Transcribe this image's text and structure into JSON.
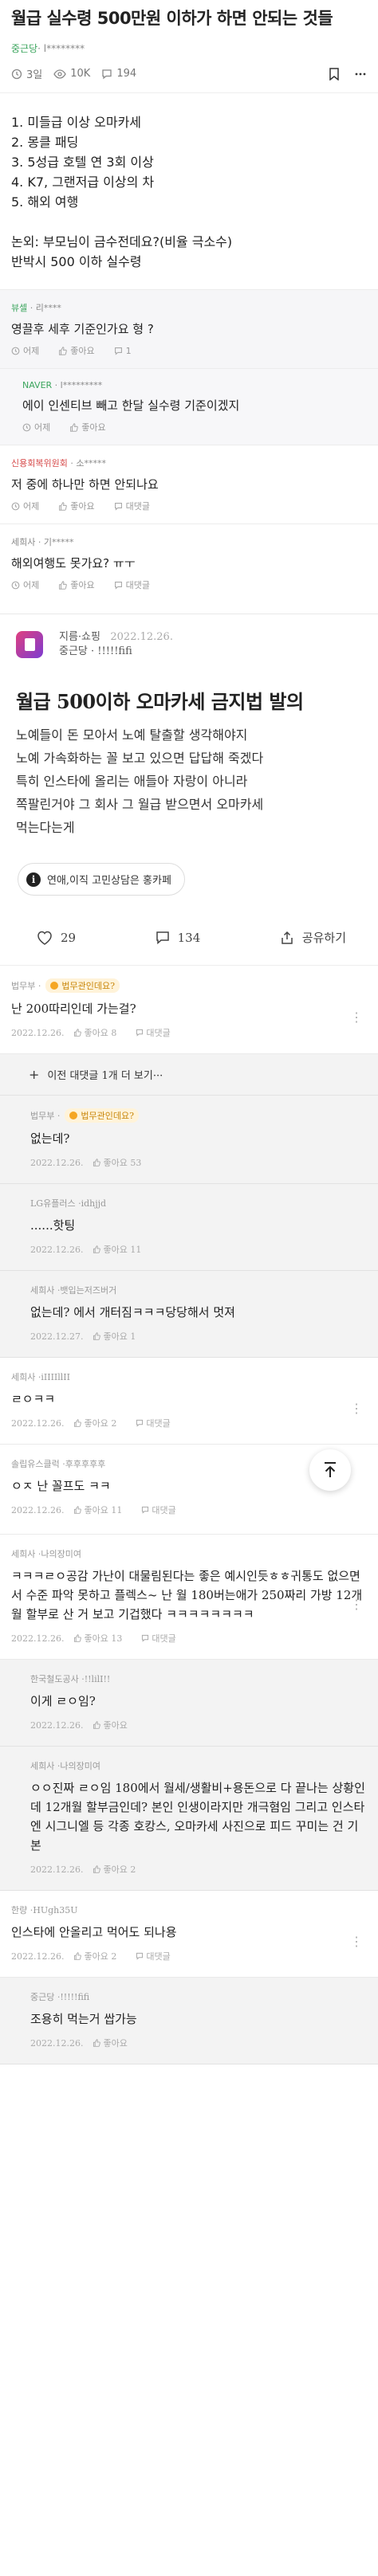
{
  "post": {
    "title": "월급 실수령 500만원 이하가 하면 안되는 것들",
    "company": "중근당",
    "author": "· l********",
    "days": "3일",
    "views": "10K",
    "comments": "194",
    "body_lines": [
      "1. 미들급 이상 오마카세",
      "2. 몽클 패딩",
      "3. 5성급 호텔 연 3회 이상",
      "4. K7, 그랜저급 이상의 차",
      "5. 해외 여행"
    ],
    "footer_lines": [
      "논외: 부모님이 금수전데요?(비율 극소수)",
      "반박시 500 이하 실수령"
    ]
  },
  "top_comments": [
    {
      "company": "뷰셀",
      "author": " · 리****",
      "text": "영끌후 세후 기준인가요 형 ?",
      "time": "어제",
      "like": "좋아요",
      "count": "1",
      "style": "gray",
      "company_color": "green"
    },
    {
      "company": "NAVER",
      "author": " · l*********",
      "text": "에이 인센티브 빼고 한달 실수령 기준이겠지",
      "time": "어제",
      "like": "좋아요",
      "count": "",
      "style": "reply",
      "company_color": "green"
    },
    {
      "company": "신용회복위원회",
      "author": " · 소*****",
      "text": "저 중에 하나만 하면 안되나요",
      "time": "어제",
      "like": "좋아요",
      "count": "",
      "reply": "대댓글",
      "style": "plain",
      "company_color": "red"
    },
    {
      "company": "세희사",
      "author": " · 기*****",
      "text": "해외여행도 못가요? ㅠㅜ",
      "time": "어제",
      "like": "좋아요",
      "count": "",
      "reply": "대댓글",
      "style": "plain",
      "company_color": "gray"
    }
  ],
  "embed": {
    "source": "지름·쇼핑",
    "date": "2022.12.26.",
    "company": "중근당",
    "author": "!!!!!fifi",
    "title": "월급 500이하 오마카세 금지법 발의",
    "body": [
      "노예들이 돈 모아서 노예 탈출할 생각해야지",
      "노예 가속화하는 꼴 보고 있으면 답답해 죽겠다",
      "특히 인스타에 올리는 애들아 자랑이 아니라",
      "쪽팔린거야 그 회사 그 월급 받으면서 오마카세",
      "먹는다는게"
    ],
    "topic": "연애,이직 고민상담은 홍카페",
    "likes": "29",
    "comments": "134",
    "share": "공유하기"
  },
  "thread": [
    {
      "name": "법무부 · ",
      "badge": "법무관인데요?",
      "text": "난 200따리인데 가는걸?",
      "date": "2022.12.26.",
      "like": "좋아요 8",
      "reply": "대댓글",
      "style": "plain",
      "more": true
    },
    {
      "type": "expand",
      "text": "이전 대댓글 1개 더 보기···"
    },
    {
      "name": "법무부 · ",
      "badge": "법무관인데요?",
      "text": "없는데?",
      "date": "2022.12.26.",
      "like": "좋아요 53",
      "style": "reply"
    },
    {
      "name": "LG유플러스 · ",
      "author": "idhjjd",
      "text": "......핫팅",
      "date": "2022.12.26.",
      "like": "좋아요 11",
      "style": "reply"
    },
    {
      "name": "세희사 · ",
      "author": "뱃입는저즈버거",
      "text": "없는데? 에서 개터짐ㅋㅋㅋ당당해서 멋져",
      "date": "2022.12.27.",
      "like": "좋아요 1",
      "style": "reply"
    },
    {
      "name": "세희사 · ",
      "author": "iIIIIllII",
      "text": "ㄹㅇㅋㅋ",
      "date": "2022.12.26.",
      "like": "좋아요 2",
      "reply": "대댓글",
      "style": "plain",
      "more": true
    },
    {
      "name": "솔립유스클럭 · ",
      "author": "후후후후후",
      "text": "ㅇㅈ 난 꼴프도 ㅋㅋ",
      "date": "2022.12.26.",
      "like": "좋아요 11",
      "reply": "대댓글",
      "style": "plain",
      "fab": true
    },
    {
      "name": "세희사 · ",
      "author": "나의장미여",
      "text": "ㅋㅋㅋㄹㅇ공감 가난이 대물림된다는 좋은 예시인듯ㅎㅎ귀통도 없으면서 수준 파악 못하고 플렉스~ 난 월 180버는애가 250짜리 가방 12개월 할부로 산 거 보고 기겁했다 ㅋㅋㅋㅋㅋㅋㅋㅋ",
      "date": "2022.12.26.",
      "like": "좋아요 13",
      "reply": "대댓글",
      "style": "plain",
      "more": true
    },
    {
      "name": "한국철도공사 · ",
      "author": "!!lilI!!",
      "text": "이게 ㄹㅇ임?",
      "date": "2022.12.26.",
      "like": "좋아요",
      "style": "reply"
    },
    {
      "name": "세희사 · ",
      "author": "나의장미여",
      "text": "ㅇㅇ진짜 ㄹㅇ임 180에서 월세/생활비+용돈으로 다 끝나는 상황인데 12개월 할부금인데? 본인 인생이라지만 개극혐임 그리고 인스타엔 시그니엘 등 각종 호캉스, 오마카세 사진으로 피드 꾸미는 건 기본",
      "date": "2022.12.26.",
      "like": "좋아요 2",
      "style": "reply"
    },
    {
      "name": "한량 · ",
      "author": "HUgh35U",
      "text": "인스타에 안올리고 먹어도 되나용",
      "date": "2022.12.26.",
      "like": "좋아요 2",
      "reply": "대댓글",
      "style": "plain",
      "more": true
    },
    {
      "name": "중근당 · ",
      "author": "!!!!!fifi",
      "text": "조용히 먹는거 쌉가능",
      "date": "2022.12.26.",
      "like": "좋아요",
      "style": "reply"
    }
  ],
  "colors": {
    "accent_green": "#3ba55d",
    "text": "#222222",
    "muted": "#999999"
  }
}
